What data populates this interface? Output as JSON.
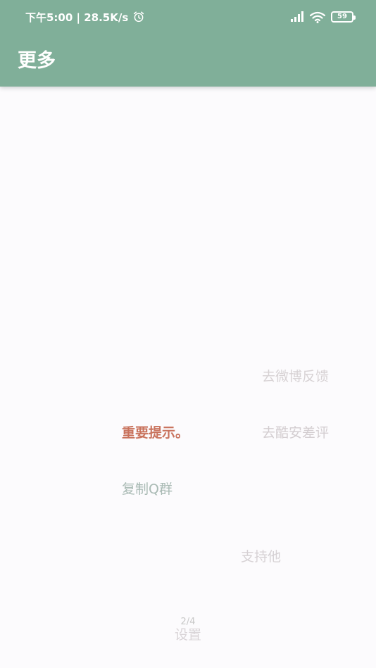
{
  "status_bar": {
    "time_speed": "下午5:00 | 28.5K/s",
    "battery_level": "59",
    "icons": [
      "alarm-icon",
      "signal-icon",
      "wifi-icon",
      "battery-icon"
    ]
  },
  "app_bar": {
    "title": "更多",
    "color": "#80af99"
  },
  "menu": {
    "weibo_feedback": "去微博反馈",
    "kuan_review": "去酷安差评",
    "important_notice": "重要提示。",
    "copy_qq_group": "复制Q群",
    "support_him": "支持他",
    "settings": "设置"
  },
  "pager": {
    "indicator": "2/4"
  },
  "colors": {
    "accent": "#80af99",
    "notice": "#c9735d",
    "background": "#fcfbfd"
  }
}
